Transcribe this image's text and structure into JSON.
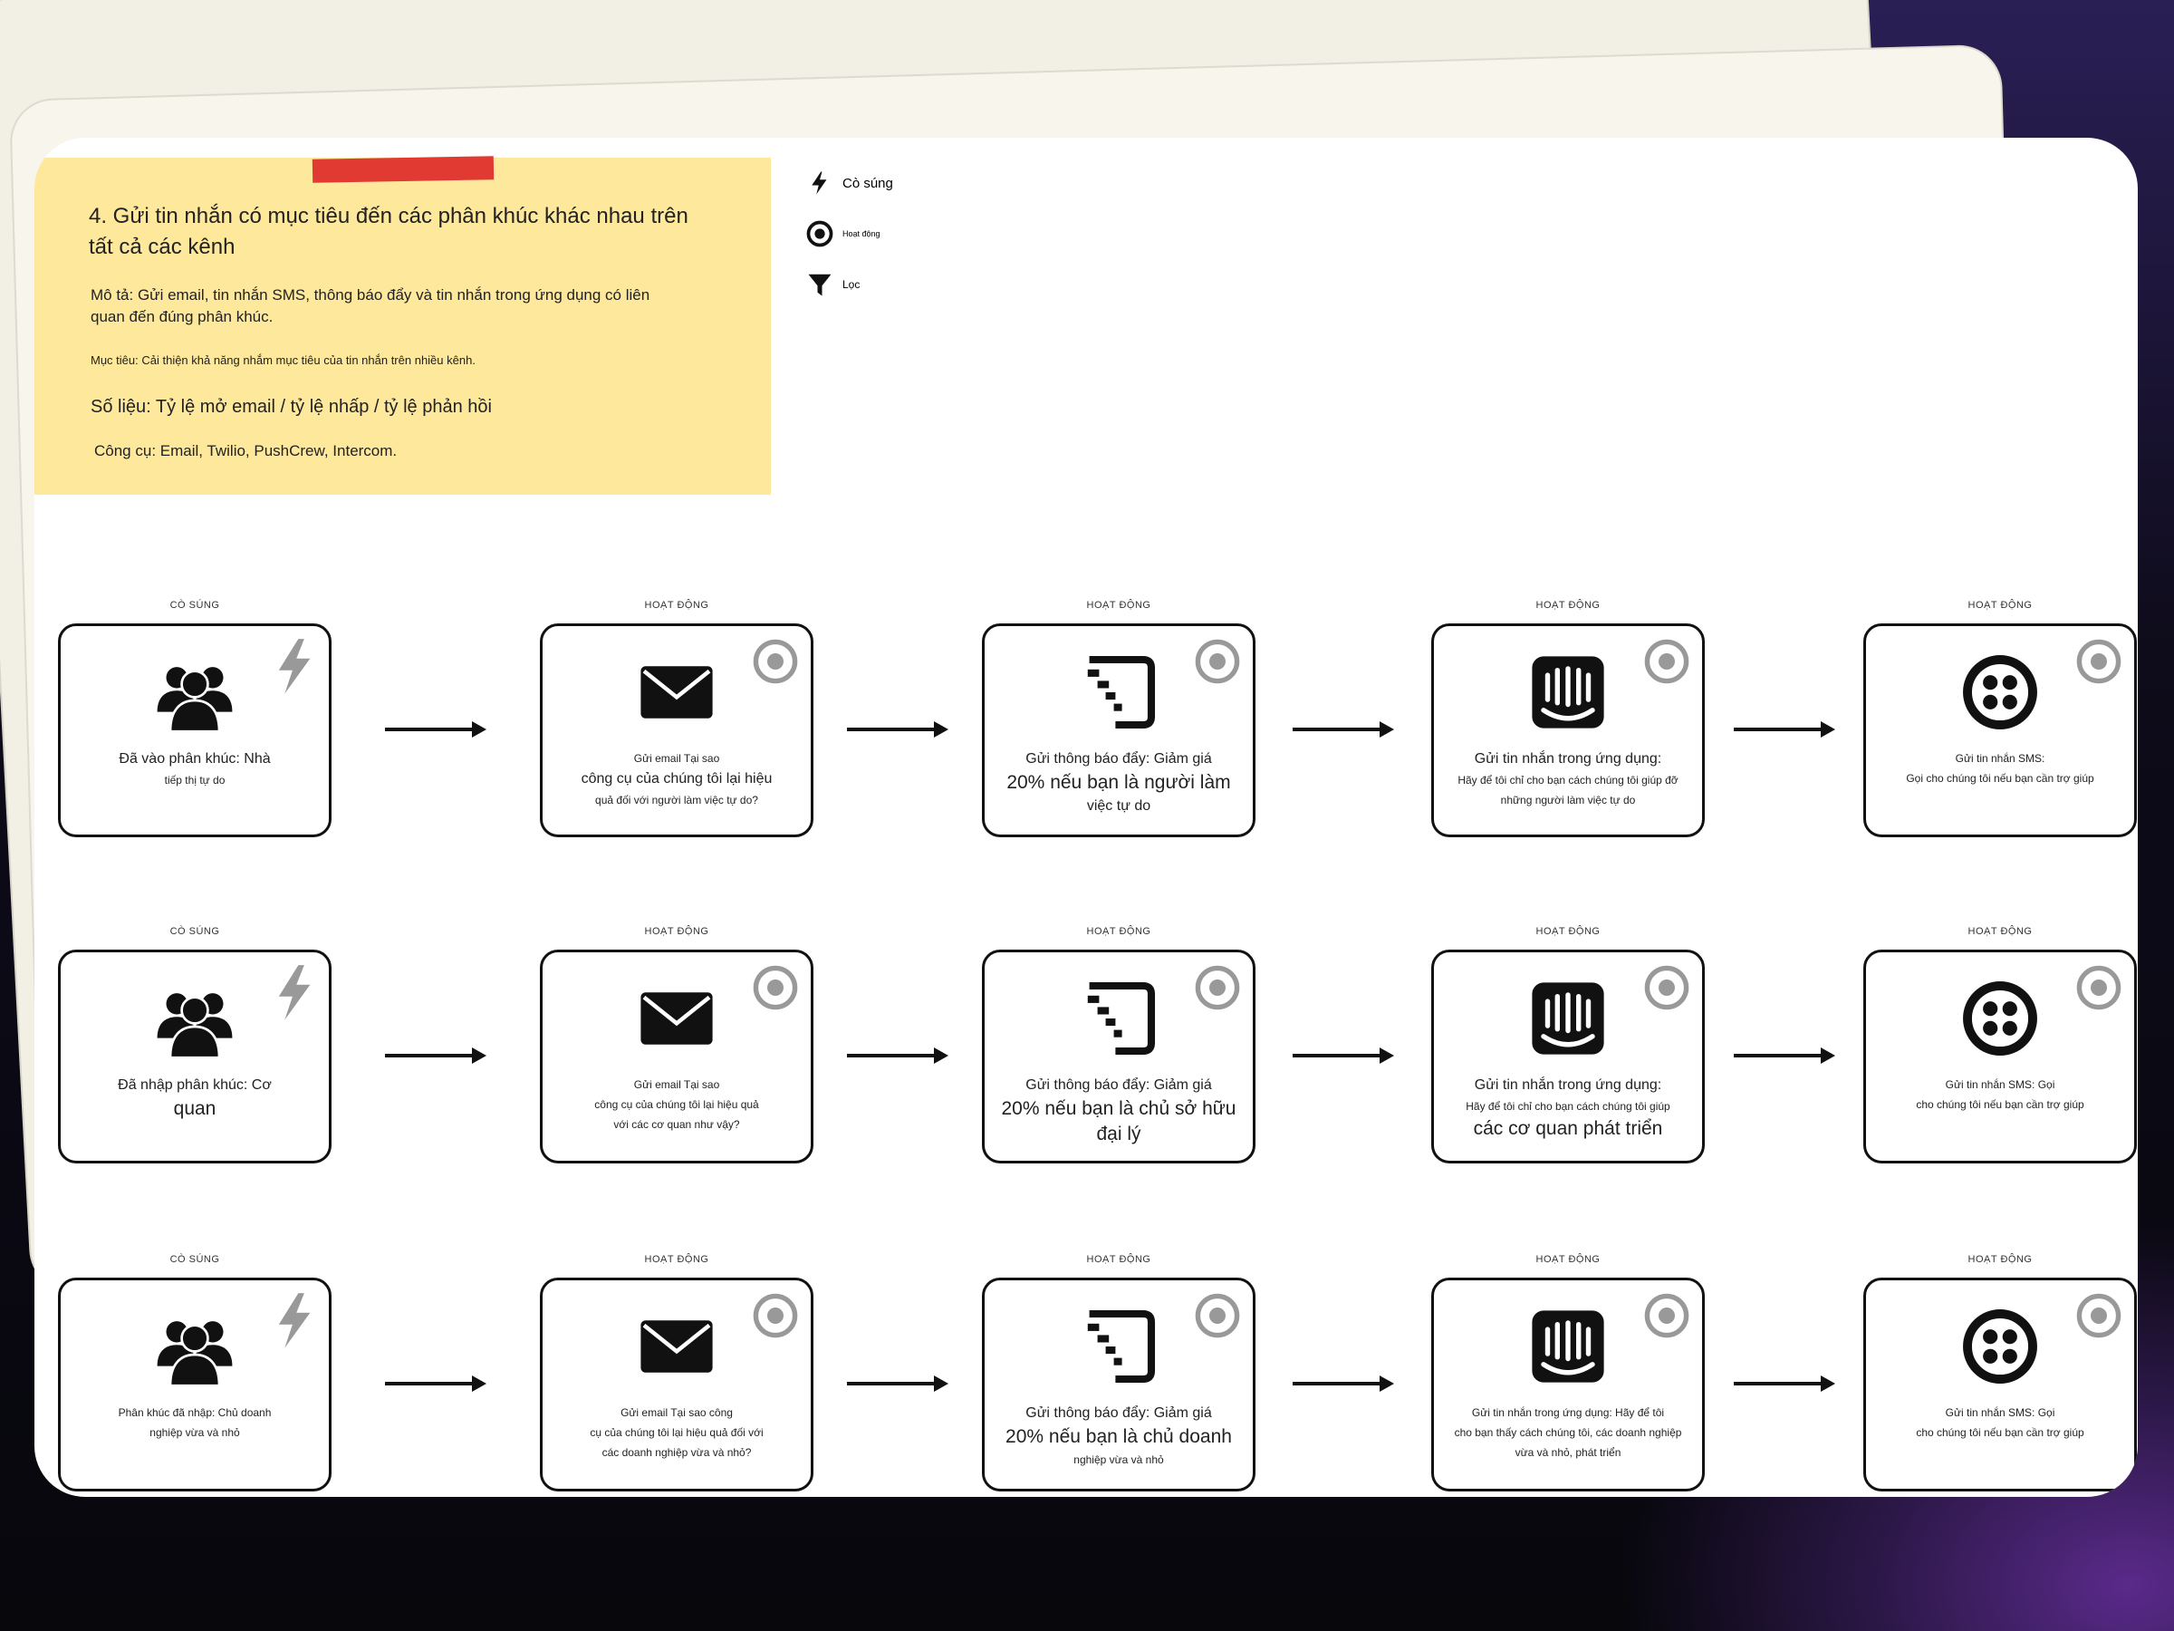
{
  "note": {
    "title": "4. Gửi tin nhắn có mục tiêu đến các phân khúc khác nhau trên tất cả các kênh",
    "description": "Mô tả: Gửi email, tin nhắn SMS, thông báo đẩy và tin nhắn trong ứng dụng có liên quan đến đúng phân khúc.",
    "goal": "Mục tiêu: Cải thiện khả năng nhắm mục tiêu của tin nhắn trên nhiều kênh.",
    "metric": "Số liệu: Tỷ lệ mở email / tỷ lệ nhấp / tỷ lệ phản hồi",
    "tools": "Công cụ: Email, Twilio, PushCrew, Intercom."
  },
  "legend": {
    "trigger": "Cò súng",
    "action": "Hoạt động",
    "filter": "Lọc"
  },
  "rows": [
    {
      "cards": [
        {
          "label": "CÒ SÚNG",
          "icon": "users-icon",
          "corner": "lightning-icon",
          "lines": [
            [
              "Đã vào phân khúc: Nhà",
              "m"
            ],
            [
              "tiếp thị tự do",
              "s"
            ]
          ]
        },
        {
          "label": "HOẠT ĐỘNG",
          "icon": "email-icon",
          "corner": "target-icon",
          "lines": [
            [
              "Gửi email Tại sao",
              "s"
            ],
            [
              "công cụ của chúng tôi lại hiệu",
              "m"
            ],
            [
              "quả đối với người làm việc tự do?",
              "s"
            ]
          ]
        },
        {
          "label": "HOẠT ĐỘNG",
          "icon": "push-icon",
          "corner": "target-icon",
          "lines": [
            [
              "Gửi thông báo đẩy: Giảm giá",
              "m"
            ],
            [
              "20% nếu bạn là người làm",
              "l"
            ],
            [
              "việc tự do",
              "m"
            ]
          ]
        },
        {
          "label": "HOẠT ĐỘNG",
          "icon": "intercom-icon",
          "corner": "target-icon",
          "lines": [
            [
              "Gửi tin nhắn trong ứng dụng:",
              "m"
            ],
            [
              "Hãy để tôi chỉ cho bạn cách chúng tôi giúp đỡ",
              "s"
            ],
            [
              "những người làm việc tự do",
              "s"
            ]
          ]
        },
        {
          "label": "HOẠT ĐỘNG",
          "icon": "twilio-icon",
          "corner": "target-icon",
          "lines": [
            [
              "Gửi tin nhắn SMS:",
              "s"
            ],
            [
              "Gọi cho chúng tôi nếu bạn cần trợ giúp",
              "s"
            ]
          ]
        }
      ]
    },
    {
      "cards": [
        {
          "label": "CÒ SÚNG",
          "icon": "users-icon",
          "corner": "lightning-icon",
          "lines": [
            [
              "Đã nhập phân khúc: Cơ",
              "m"
            ],
            [
              "quan",
              "l"
            ]
          ]
        },
        {
          "label": "HOẠT ĐỘNG",
          "icon": "email-icon",
          "corner": "target-icon",
          "lines": [
            [
              "Gửi email Tại sao",
              "s"
            ],
            [
              "công cụ của chúng tôi lại hiệu quả",
              "s"
            ],
            [
              "với các cơ quan như vậy?",
              "s"
            ]
          ]
        },
        {
          "label": "HOẠT ĐỘNG",
          "icon": "push-icon",
          "corner": "target-icon",
          "lines": [
            [
              "Gửi thông báo đẩy: Giảm giá",
              "m"
            ],
            [
              "20% nếu bạn là chủ sở hữu",
              "l"
            ],
            [
              "đại lý",
              "l"
            ]
          ]
        },
        {
          "label": "HOẠT ĐỘNG",
          "icon": "intercom-icon",
          "corner": "target-icon",
          "lines": [
            [
              "Gửi tin nhắn trong ứng dụng:",
              "m"
            ],
            [
              "Hãy để tôi chỉ cho bạn cách chúng tôi giúp",
              "s"
            ],
            [
              "các cơ quan phát triển",
              "l"
            ]
          ]
        },
        {
          "label": "HOẠT ĐỘNG",
          "icon": "twilio-icon",
          "corner": "target-icon",
          "lines": [
            [
              "Gửi tin nhắn SMS: Gọi",
              "s"
            ],
            [
              "cho chúng tôi nếu bạn cần trợ giúp",
              "s"
            ]
          ]
        }
      ]
    },
    {
      "cards": [
        {
          "label": "CÒ SÚNG",
          "icon": "users-icon",
          "corner": "lightning-icon",
          "lines": [
            [
              "Phân khúc đã nhập: Chủ doanh",
              "s"
            ],
            [
              "nghiệp vừa và nhỏ",
              "s"
            ]
          ]
        },
        {
          "label": "HOẠT ĐỘNG",
          "icon": "email-icon",
          "corner": "target-icon",
          "lines": [
            [
              "Gửi email Tại sao công",
              "s"
            ],
            [
              "cụ của chúng tôi lại hiệu quả đối với",
              "s"
            ],
            [
              "các doanh nghiệp vừa và nhỏ?",
              "s"
            ]
          ]
        },
        {
          "label": "HOẠT ĐỘNG",
          "icon": "push-icon",
          "corner": "target-icon",
          "lines": [
            [
              "Gửi thông báo đẩy: Giảm giá",
              "m"
            ],
            [
              "20% nếu bạn là chủ doanh",
              "l"
            ],
            [
              "nghiệp vừa và nhỏ",
              "s"
            ]
          ]
        },
        {
          "label": "HOẠT ĐỘNG",
          "icon": "intercom-icon",
          "corner": "target-icon",
          "lines": [
            [
              "Gửi tin nhắn trong ứng dụng: Hãy để tôi",
              "s"
            ],
            [
              "cho bạn thấy cách chúng tôi, các doanh nghiệp",
              "s"
            ],
            [
              "vừa và nhỏ, phát triển",
              "s"
            ]
          ]
        },
        {
          "label": "HOẠT ĐỘNG",
          "icon": "twilio-icon",
          "corner": "target-icon",
          "lines": [
            [
              "Gửi tin nhắn SMS: Gọi",
              "s"
            ],
            [
              "cho chúng tôi nếu bạn cần trợ giúp",
              "s"
            ]
          ]
        }
      ]
    }
  ]
}
